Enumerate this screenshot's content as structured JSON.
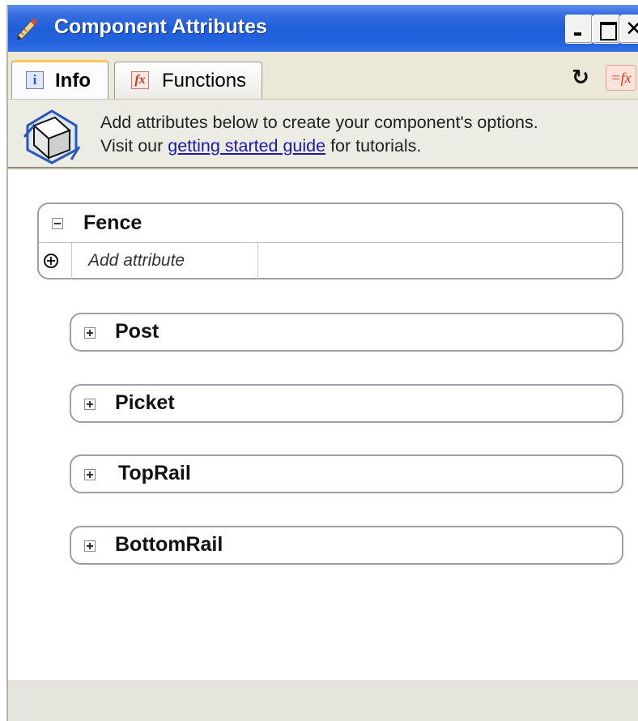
{
  "window": {
    "title": "Component Attributes",
    "title_icon": "pencil-ruler-icon",
    "controls": {
      "minimize": "minimize-icon",
      "maximize": "maximize-icon",
      "close": "✕"
    }
  },
  "tabs": [
    {
      "label": "Info",
      "icon": "info-icon",
      "icon_glyph": "i",
      "selected": true
    },
    {
      "label": "Functions",
      "icon": "fx-icon",
      "icon_glyph": "fx",
      "selected": false
    }
  ],
  "toolbar": {
    "refresh_icon": "refresh-icon",
    "refresh_glyph": "↻",
    "fx_icon": "formula-icon",
    "fx_glyph": "=fx"
  },
  "info": {
    "line1": "Add attributes below to create your component's options.",
    "line2_prefix": "Visit our ",
    "link_text": "getting started guide",
    "line2_suffix": " for tutorials."
  },
  "fence": {
    "name": "Fence",
    "expanded": true,
    "add_attribute_label": "Add attribute",
    "add_glyph": "+"
  },
  "subcomponents": [
    {
      "name": "Post",
      "expanded": false
    },
    {
      "name": "Picket",
      "expanded": false
    },
    {
      "name": "TopRail",
      "expanded": false
    },
    {
      "name": "BottomRail",
      "expanded": false
    }
  ],
  "colors": {
    "titlebar": "#2464de",
    "link": "#1a1aa6",
    "panel_border": "#9ca0a6",
    "window_bg": "#ece9d8"
  }
}
